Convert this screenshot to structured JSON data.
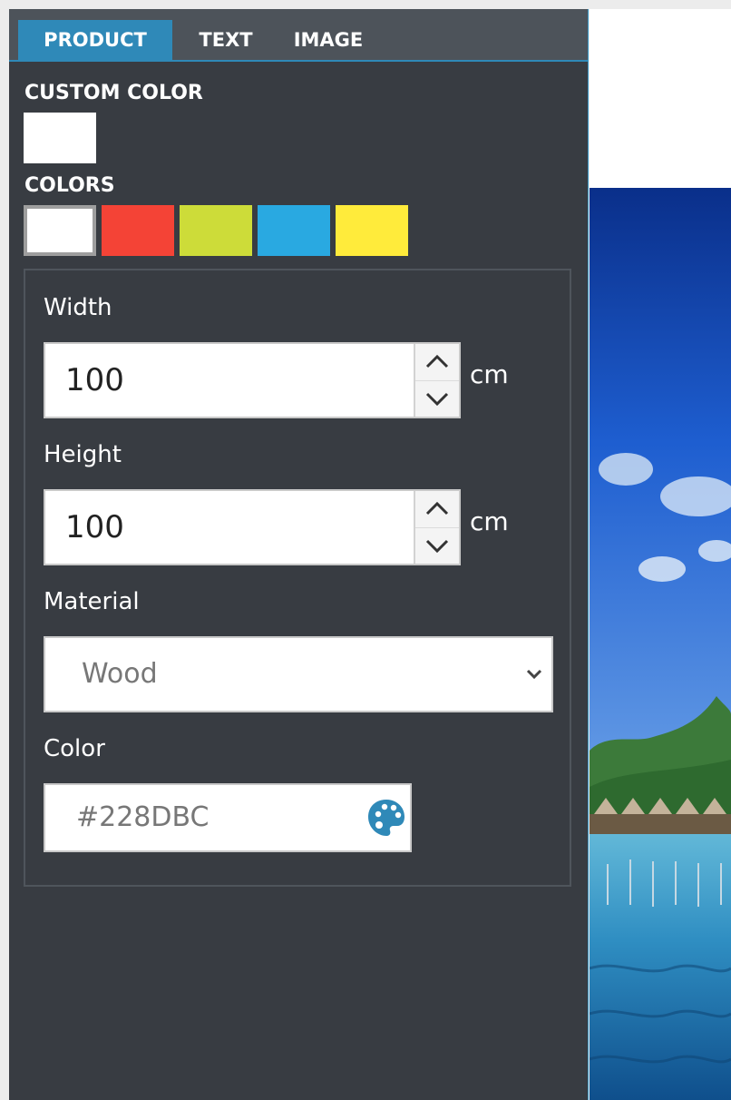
{
  "tabs": [
    {
      "label": "PRODUCT",
      "active": true
    },
    {
      "label": "TEXT",
      "active": false
    },
    {
      "label": "IMAGE",
      "active": false
    }
  ],
  "custom_color": {
    "label": "CUSTOM COLOR",
    "value": "#ffffff"
  },
  "colors": {
    "label": "COLORS",
    "swatches": [
      "#ffffff",
      "#f44336",
      "#cddc39",
      "#29a9e1",
      "#ffeb3b"
    ],
    "selected_index": 0
  },
  "width_field": {
    "label": "Width",
    "value": "100",
    "unit": "cm"
  },
  "height_field": {
    "label": "Height",
    "value": "100",
    "unit": "cm"
  },
  "material": {
    "label": "Material",
    "selected": "Wood"
  },
  "color_field": {
    "label": "Color",
    "placeholder": "#228DBC",
    "icon": "palette-icon",
    "icon_color": "#2f89b8"
  },
  "theme": {
    "panel_bg": "#383c42",
    "tab_bar_bg": "#4d535a",
    "accent": "#2f89b8"
  },
  "canvas": {
    "image": "tropical-lagoon-photo"
  }
}
